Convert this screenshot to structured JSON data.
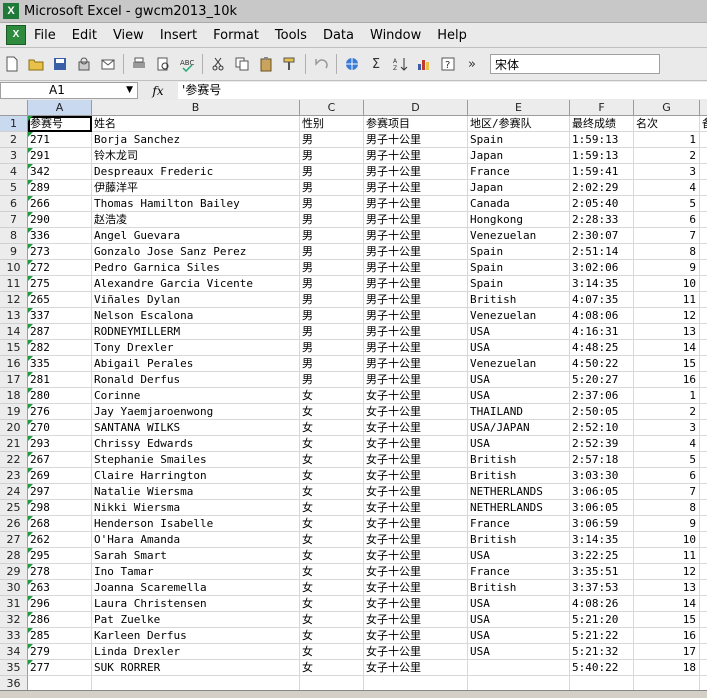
{
  "window": {
    "title": "Microsoft Excel - gwcm2013_10k"
  },
  "menu": [
    "File",
    "Edit",
    "View",
    "Insert",
    "Format",
    "Tools",
    "Data",
    "Window",
    "Help"
  ],
  "toolbar": {
    "font_name": "宋体",
    "overflow_label": "»"
  },
  "formula_bar": {
    "name_box": "A1",
    "fx_label": "fx",
    "formula": "'参赛号"
  },
  "columns": [
    "A",
    "B",
    "C",
    "D",
    "E",
    "F",
    "G",
    "H"
  ],
  "headers": [
    "参赛号",
    "姓名",
    "性别",
    "参赛项目",
    "地区/参赛队",
    "最终成绩",
    "名次",
    "备"
  ],
  "rows": [
    [
      "271",
      "Borja Sanchez",
      "男",
      "男子十公里",
      "Spain",
      "1:59:13",
      "1"
    ],
    [
      "291",
      "铃木龙司",
      "男",
      "男子十公里",
      "Japan",
      "1:59:13",
      "2"
    ],
    [
      "342",
      "Despreaux Frederic",
      "男",
      "男子十公里",
      "France",
      "1:59:41",
      "3"
    ],
    [
      "289",
      "伊藤洋平",
      "男",
      "男子十公里",
      "Japan",
      "2:02:29",
      "4"
    ],
    [
      "266",
      "Thomas Hamilton Bailey",
      "男",
      "男子十公里",
      "Canada",
      "2:05:40",
      "5"
    ],
    [
      "290",
      "赵浩凌",
      "男",
      "男子十公里",
      "Hongkong",
      "2:28:33",
      "6"
    ],
    [
      "336",
      "Angel Guevara",
      "男",
      "男子十公里",
      "Venezuelan",
      "2:30:07",
      "7"
    ],
    [
      "273",
      "Gonzalo Jose Sanz Perez",
      "男",
      "男子十公里",
      "Spain",
      "2:51:14",
      "8"
    ],
    [
      "272",
      "Pedro Garnica Siles",
      "男",
      "男子十公里",
      "Spain",
      "3:02:06",
      "9"
    ],
    [
      "275",
      "Alexandre Garcia Vicente",
      "男",
      "男子十公里",
      "Spain",
      "3:14:35",
      "10"
    ],
    [
      "265",
      "Viñales Dylan",
      "男",
      "男子十公里",
      "British",
      "4:07:35",
      "11"
    ],
    [
      "337",
      "Nelson Escalona",
      "男",
      "男子十公里",
      "Venezuelan",
      "4:08:06",
      "12"
    ],
    [
      "287",
      "RODNEYMILLERM",
      "男",
      "男子十公里",
      "USA",
      "4:16:31",
      "13"
    ],
    [
      "282",
      "Tony Drexler",
      "男",
      "男子十公里",
      "USA",
      "4:48:25",
      "14"
    ],
    [
      "335",
      "Abigail Perales",
      "男",
      "男子十公里",
      "Venezuelan",
      "4:50:22",
      "15"
    ],
    [
      "281",
      "Ronald Derfus",
      "男",
      "男子十公里",
      "USA",
      "5:20:27",
      "16"
    ],
    [
      "280",
      "Corinne",
      "女",
      "女子十公里",
      "USA",
      "2:37:06",
      "1"
    ],
    [
      "276",
      "Jay Yaemjaroenwong",
      "女",
      "女子十公里",
      "THAILAND",
      "2:50:05",
      "2"
    ],
    [
      "270",
      "SANTANA WILKS",
      "女",
      "女子十公里",
      "USA/JAPAN",
      "2:52:10",
      "3"
    ],
    [
      "293",
      "Chrissy Edwards",
      "女",
      "女子十公里",
      "USA",
      "2:52:39",
      "4"
    ],
    [
      "267",
      "Stephanie Smailes",
      "女",
      "女子十公里",
      "British",
      "2:57:18",
      "5"
    ],
    [
      "269",
      "Claire Harrington",
      "女",
      "女子十公里",
      "British",
      "3:03:30",
      "6"
    ],
    [
      "297",
      "Natalie Wiersma",
      "女",
      "女子十公里",
      "NETHERLANDS",
      "3:06:05",
      "7"
    ],
    [
      "298",
      "Nikki Wiersma",
      "女",
      "女子十公里",
      "NETHERLANDS",
      "3:06:05",
      "8"
    ],
    [
      "268",
      "Henderson Isabelle",
      "女",
      "女子十公里",
      "France",
      "3:06:59",
      "9"
    ],
    [
      "262",
      "O'Hara  Amanda",
      "女",
      "女子十公里",
      "British",
      "3:14:35",
      "10"
    ],
    [
      "295",
      "Sarah Smart",
      "女",
      "女子十公里",
      "USA",
      "3:22:25",
      "11"
    ],
    [
      "278",
      "Ino Tamar",
      "女",
      "女子十公里",
      "France",
      "3:35:51",
      "12"
    ],
    [
      "263",
      "Joanna Scaremella",
      "女",
      "女子十公里",
      "British",
      "3:37:53",
      "13"
    ],
    [
      "296",
      "Laura Christensen",
      "女",
      "女子十公里",
      "USA",
      "4:08:26",
      "14"
    ],
    [
      "286",
      "Pat Zuelke",
      "女",
      "女子十公里",
      "USA",
      "5:21:20",
      "15"
    ],
    [
      "285",
      "Karleen Derfus",
      "女",
      "女子十公里",
      "USA",
      "5:21:22",
      "16"
    ],
    [
      "279",
      "Linda Drexler",
      "女",
      "女子十公里",
      "USA",
      "5:21:32",
      "17"
    ],
    [
      "277",
      "SUK RORRER",
      "女",
      "女子十公里",
      "",
      "5:40:22",
      "18"
    ]
  ],
  "colors": {
    "indicator": "#1f9a3a",
    "selected_header": "#c9d9f0"
  }
}
